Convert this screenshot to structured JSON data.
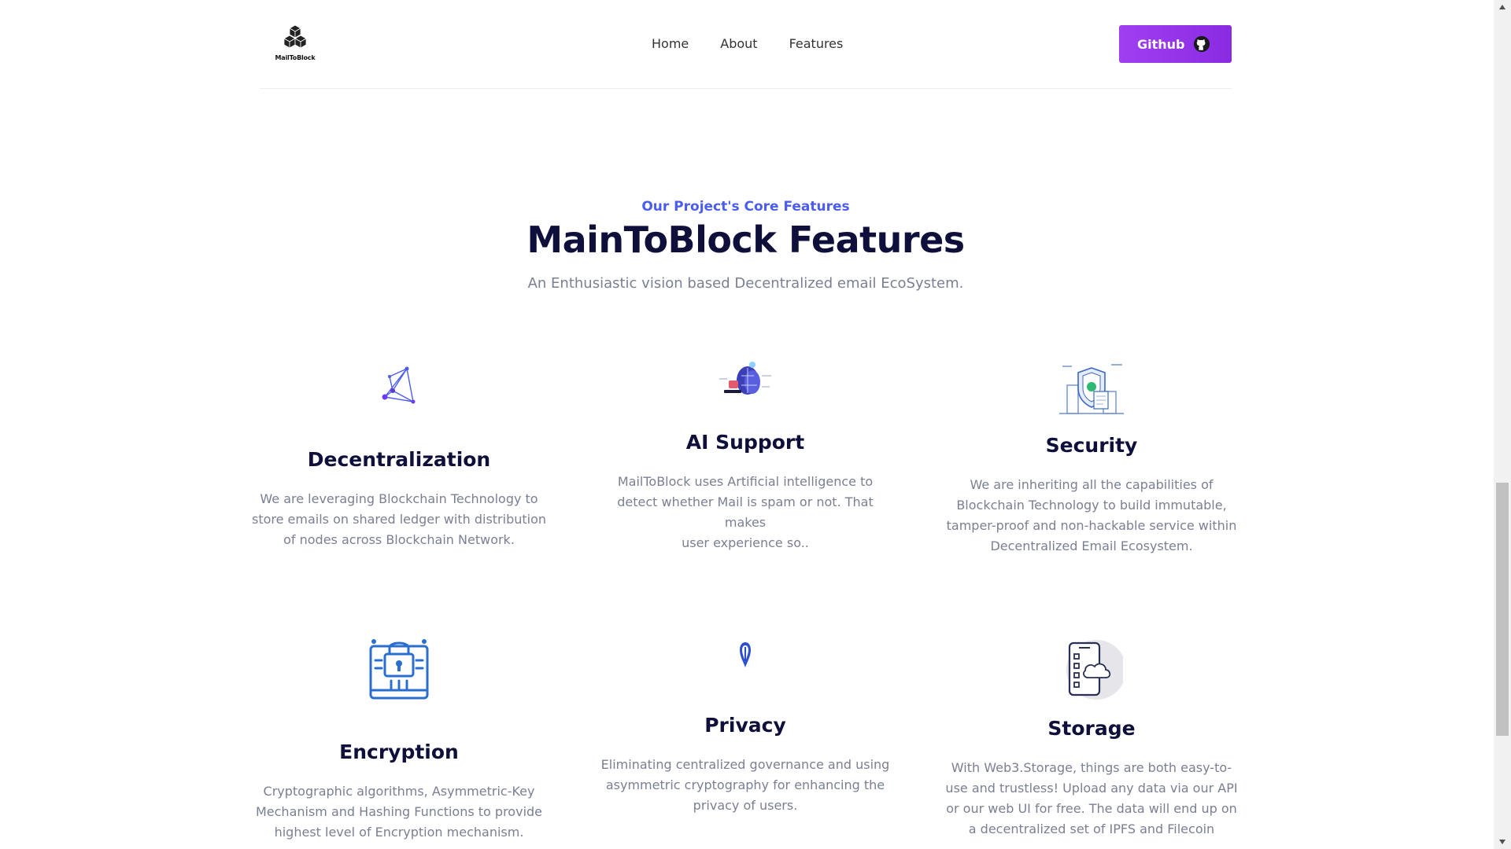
{
  "header": {
    "logo_text": "MailToBlock",
    "nav": [
      "Home",
      "About",
      "Features"
    ],
    "github_label": "Github"
  },
  "intro": {
    "eyebrow": "Our Project's Core Features",
    "title": "MainToBlock Features",
    "subtitle": "An Enthusiastic vision based Decentralized email EcoSystem."
  },
  "features": [
    {
      "icon": "network-icon",
      "title": "Decentralization",
      "lines": [
        "We are leveraging Blockchain Technology to",
        "store emails on shared ledger with distribution",
        "of nodes across Blockchain Network."
      ]
    },
    {
      "icon": "ai-brain-icon",
      "title": "AI Support",
      "lines": [
        "MailToBlock uses Artificial intelligence to",
        "detect whether Mail is spam or not. That makes",
        "user experience so.."
      ]
    },
    {
      "icon": "shield-security-icon",
      "title": "Security",
      "lines": [
        "We are inheriting all the capabilities of",
        "Blockchain Technology to build immutable,",
        "tamper-proof and non-hackable service within",
        "Decentralized Email Ecosystem."
      ]
    },
    {
      "icon": "encryption-lock-icon",
      "title": "Encryption",
      "lines": [
        "Cryptographic algorithms, Asymmetric-Key",
        "Mechanism and Hashing Functions to provide",
        "highest level of Encryption mechanism."
      ]
    },
    {
      "icon": "privacy-pin-icon",
      "title": "Privacy",
      "lines": [
        "Eliminating centralized governance and using",
        "asymmetric cryptography for enhancing the",
        "privacy of users."
      ]
    },
    {
      "icon": "cloud-storage-icon",
      "title": "Storage",
      "lines": [
        "With Web3.Storage, things are both easy-to-",
        "use and trustless! Upload any data via our API",
        "or our web UI for free. The data will end up on",
        "a decentralized set of IPFS and Filecoin"
      ]
    }
  ],
  "colors": {
    "accent": "#4a5df0",
    "button_gradient_start": "#a03ef2",
    "button_gradient_end": "#8a2be2",
    "heading": "#0e0f3a",
    "muted_text": "#7a7f93"
  }
}
